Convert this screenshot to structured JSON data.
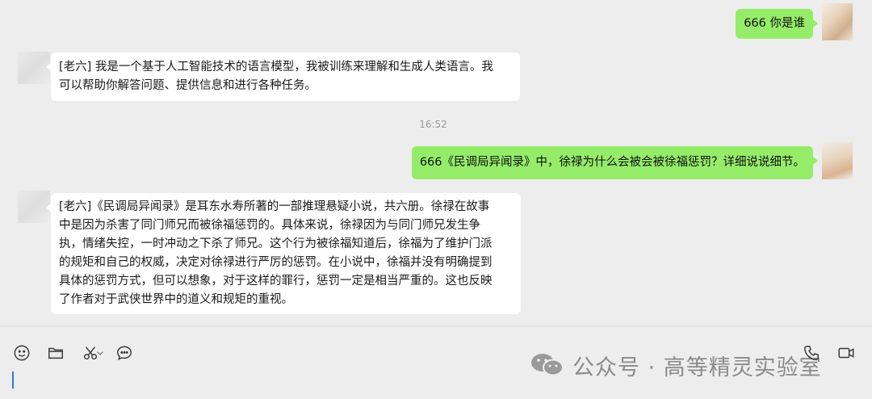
{
  "chat": {
    "messages": [
      {
        "id": "m1",
        "sender": "self",
        "text": "666 你是谁"
      },
      {
        "id": "m2",
        "sender": "other",
        "lines": [
          "[老六] 我是一个基于人工智能技术的语言模型，我被训练来理解和生成人类语言。我",
          "可以帮助你解答问题、提供信息和进行各种任务。"
        ]
      },
      {
        "id": "m3",
        "sender": "self",
        "text": "666《民调局异闻录》中，徐禄为什么会被会被徐福惩罚？详细说说细节。"
      },
      {
        "id": "m4",
        "sender": "other",
        "lines": [
          "[老六]《民调局异闻录》是耳东水寿所著的一部推理悬疑小说，共六册。徐禄在故事",
          "中是因为杀害了同门师兄而被徐福惩罚的。具体来说，徐禄因为与同门师兄发生争",
          "执，情绪失控，一时冲动之下杀了师兄。这个行为被徐福知道后，徐福为了维护门派",
          "的规矩和自己的权威，决定对徐禄进行严厉的惩罚。在小说中，徐福并没有明确提到",
          "具体的惩罚方式，但可以想象，对于这样的罪行，惩罚一定是相当严重的。这也反映",
          "了作者对于武侠世界中的道义和规矩的重视。"
        ]
      }
    ],
    "timestamp": "16:52"
  },
  "toolbar": {
    "tools": [
      "emoji-icon",
      "folder-icon",
      "scissors-icon",
      "chevron-down-icon",
      "chat-bubble-icon",
      "phone-icon",
      "video-call-icon"
    ]
  },
  "watermark": {
    "text": "公众号 · 高等精灵实验室"
  },
  "colors": {
    "self_bubble": "#95ec69",
    "other_bubble": "#ffffff",
    "background": "#ededed",
    "cursor": "#2c7be5"
  }
}
